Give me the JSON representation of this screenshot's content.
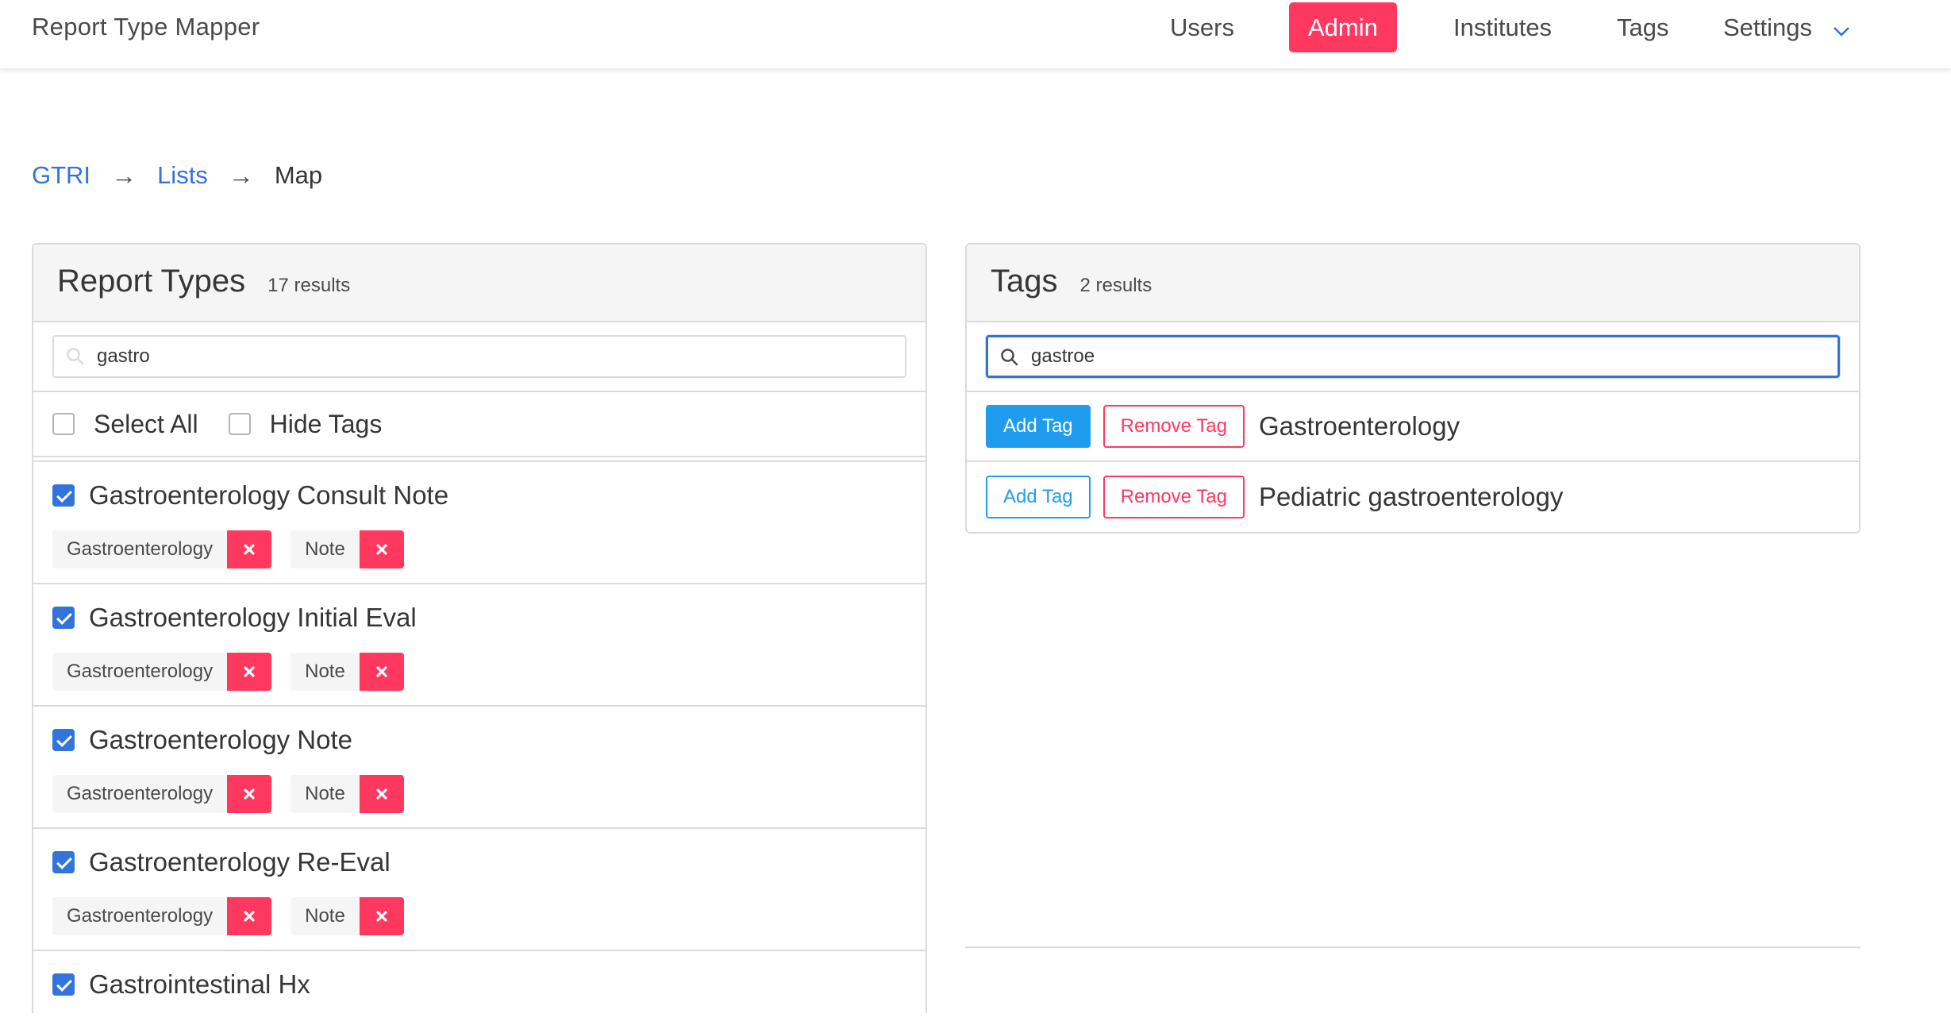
{
  "navbar": {
    "brand": "Report Type Mapper",
    "items": [
      {
        "label": "Users"
      },
      {
        "label": "Admin",
        "active": true
      },
      {
        "label": "Institutes"
      },
      {
        "label": "Tags"
      },
      {
        "label": "Settings"
      }
    ],
    "accent_color": "#ff3860"
  },
  "breadcrumb": {
    "items": [
      "GTRI",
      "Lists",
      "Map"
    ],
    "separator": "→"
  },
  "report_types_panel": {
    "title": "Report Types",
    "count": "17 results",
    "search_value": "gastro",
    "select_all_label": "Select All",
    "hide_tags_label": "Hide Tags",
    "items": [
      {
        "name": "Gastroenterology Consult Note",
        "checked": true,
        "tags": [
          "Gastroenterology",
          "Note"
        ]
      },
      {
        "name": "Gastroenterology Initial Eval",
        "checked": true,
        "tags": [
          "Gastroenterology",
          "Note"
        ]
      },
      {
        "name": "Gastroenterology Note",
        "checked": true,
        "tags": [
          "Gastroenterology",
          "Note"
        ]
      },
      {
        "name": "Gastroenterology Re-Eval",
        "checked": true,
        "tags": [
          "Gastroenterology",
          "Note"
        ]
      },
      {
        "name": "Gastrointestinal Hx",
        "checked": true,
        "tags": []
      }
    ]
  },
  "tags_panel": {
    "title": "Tags",
    "count": "2 results",
    "search_value": "gastroe",
    "add_label": "Add Tag",
    "remove_label": "Remove Tag",
    "items": [
      {
        "name": "Gastroenterology"
      },
      {
        "name": "Pediatric gastroenterology"
      }
    ]
  },
  "colors": {
    "primary_link": "#3273dc",
    "info": "#209cee",
    "danger": "#ff3860"
  }
}
